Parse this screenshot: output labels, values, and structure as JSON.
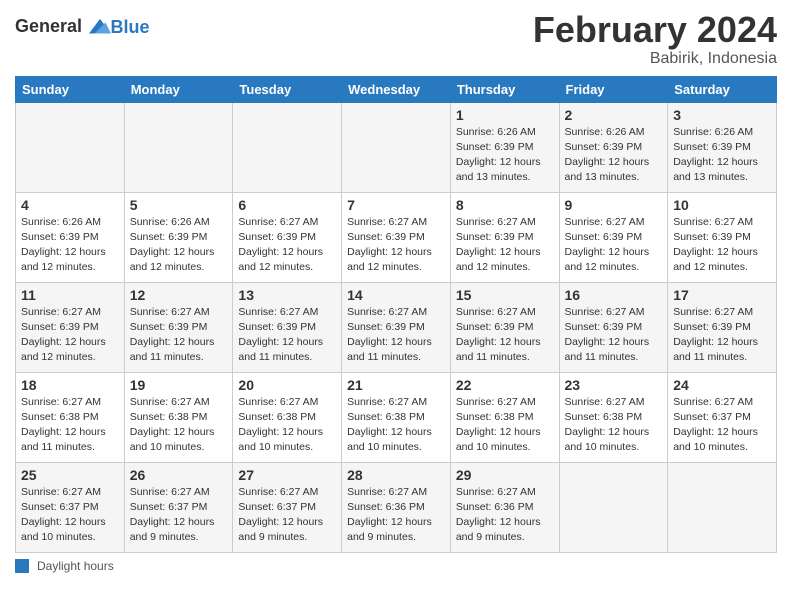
{
  "header": {
    "logo_general": "General",
    "logo_blue": "Blue",
    "title": "February 2024",
    "subtitle": "Babirik, Indonesia"
  },
  "footer": {
    "daylight_label": "Daylight hours"
  },
  "columns": [
    "Sunday",
    "Monday",
    "Tuesday",
    "Wednesday",
    "Thursday",
    "Friday",
    "Saturday"
  ],
  "weeks": [
    [
      {
        "day": "",
        "info": ""
      },
      {
        "day": "",
        "info": ""
      },
      {
        "day": "",
        "info": ""
      },
      {
        "day": "",
        "info": ""
      },
      {
        "day": "1",
        "info": "Sunrise: 6:26 AM\nSunset: 6:39 PM\nDaylight: 12 hours\nand 13 minutes."
      },
      {
        "day": "2",
        "info": "Sunrise: 6:26 AM\nSunset: 6:39 PM\nDaylight: 12 hours\nand 13 minutes."
      },
      {
        "day": "3",
        "info": "Sunrise: 6:26 AM\nSunset: 6:39 PM\nDaylight: 12 hours\nand 13 minutes."
      }
    ],
    [
      {
        "day": "4",
        "info": "Sunrise: 6:26 AM\nSunset: 6:39 PM\nDaylight: 12 hours\nand 12 minutes."
      },
      {
        "day": "5",
        "info": "Sunrise: 6:26 AM\nSunset: 6:39 PM\nDaylight: 12 hours\nand 12 minutes."
      },
      {
        "day": "6",
        "info": "Sunrise: 6:27 AM\nSunset: 6:39 PM\nDaylight: 12 hours\nand 12 minutes."
      },
      {
        "day": "7",
        "info": "Sunrise: 6:27 AM\nSunset: 6:39 PM\nDaylight: 12 hours\nand 12 minutes."
      },
      {
        "day": "8",
        "info": "Sunrise: 6:27 AM\nSunset: 6:39 PM\nDaylight: 12 hours\nand 12 minutes."
      },
      {
        "day": "9",
        "info": "Sunrise: 6:27 AM\nSunset: 6:39 PM\nDaylight: 12 hours\nand 12 minutes."
      },
      {
        "day": "10",
        "info": "Sunrise: 6:27 AM\nSunset: 6:39 PM\nDaylight: 12 hours\nand 12 minutes."
      }
    ],
    [
      {
        "day": "11",
        "info": "Sunrise: 6:27 AM\nSunset: 6:39 PM\nDaylight: 12 hours\nand 12 minutes."
      },
      {
        "day": "12",
        "info": "Sunrise: 6:27 AM\nSunset: 6:39 PM\nDaylight: 12 hours\nand 11 minutes."
      },
      {
        "day": "13",
        "info": "Sunrise: 6:27 AM\nSunset: 6:39 PM\nDaylight: 12 hours\nand 11 minutes."
      },
      {
        "day": "14",
        "info": "Sunrise: 6:27 AM\nSunset: 6:39 PM\nDaylight: 12 hours\nand 11 minutes."
      },
      {
        "day": "15",
        "info": "Sunrise: 6:27 AM\nSunset: 6:39 PM\nDaylight: 12 hours\nand 11 minutes."
      },
      {
        "day": "16",
        "info": "Sunrise: 6:27 AM\nSunset: 6:39 PM\nDaylight: 12 hours\nand 11 minutes."
      },
      {
        "day": "17",
        "info": "Sunrise: 6:27 AM\nSunset: 6:39 PM\nDaylight: 12 hours\nand 11 minutes."
      }
    ],
    [
      {
        "day": "18",
        "info": "Sunrise: 6:27 AM\nSunset: 6:38 PM\nDaylight: 12 hours\nand 11 minutes."
      },
      {
        "day": "19",
        "info": "Sunrise: 6:27 AM\nSunset: 6:38 PM\nDaylight: 12 hours\nand 10 minutes."
      },
      {
        "day": "20",
        "info": "Sunrise: 6:27 AM\nSunset: 6:38 PM\nDaylight: 12 hours\nand 10 minutes."
      },
      {
        "day": "21",
        "info": "Sunrise: 6:27 AM\nSunset: 6:38 PM\nDaylight: 12 hours\nand 10 minutes."
      },
      {
        "day": "22",
        "info": "Sunrise: 6:27 AM\nSunset: 6:38 PM\nDaylight: 12 hours\nand 10 minutes."
      },
      {
        "day": "23",
        "info": "Sunrise: 6:27 AM\nSunset: 6:38 PM\nDaylight: 12 hours\nand 10 minutes."
      },
      {
        "day": "24",
        "info": "Sunrise: 6:27 AM\nSunset: 6:37 PM\nDaylight: 12 hours\nand 10 minutes."
      }
    ],
    [
      {
        "day": "25",
        "info": "Sunrise: 6:27 AM\nSunset: 6:37 PM\nDaylight: 12 hours\nand 10 minutes."
      },
      {
        "day": "26",
        "info": "Sunrise: 6:27 AM\nSunset: 6:37 PM\nDaylight: 12 hours\nand 9 minutes."
      },
      {
        "day": "27",
        "info": "Sunrise: 6:27 AM\nSunset: 6:37 PM\nDaylight: 12 hours\nand 9 minutes."
      },
      {
        "day": "28",
        "info": "Sunrise: 6:27 AM\nSunset: 6:36 PM\nDaylight: 12 hours\nand 9 minutes."
      },
      {
        "day": "29",
        "info": "Sunrise: 6:27 AM\nSunset: 6:36 PM\nDaylight: 12 hours\nand 9 minutes."
      },
      {
        "day": "",
        "info": ""
      },
      {
        "day": "",
        "info": ""
      }
    ]
  ]
}
